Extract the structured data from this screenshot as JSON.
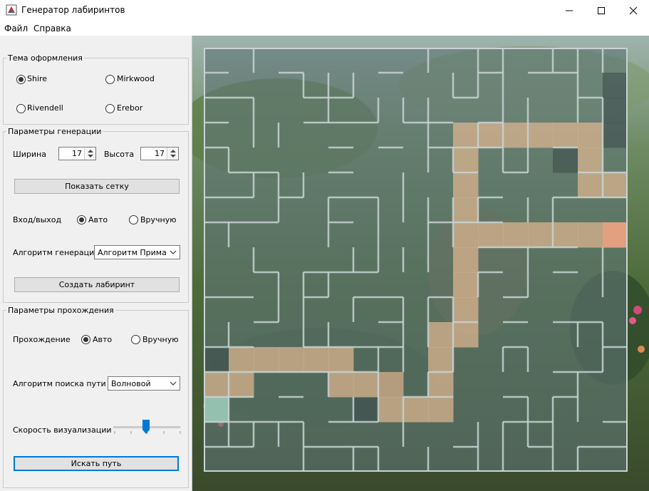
{
  "window": {
    "title": "Генератор лабиринтов"
  },
  "menu": {
    "file": "Файл",
    "help": "Справка"
  },
  "theme": {
    "legend": "Тема оформления",
    "options": [
      "Shire",
      "Mirkwood",
      "Rivendell",
      "Erebor"
    ],
    "selected": "Shire"
  },
  "gen": {
    "legend": "Параметры генерации",
    "width_label": "Ширина",
    "width_value": "17",
    "height_label": "Высота",
    "height_value": "17",
    "show_grid": "Показать сетку",
    "entry_label": "Вход/выход",
    "auto": "Авто",
    "manual": "Вручную",
    "algo_label": "Алгоритм генерации",
    "algo_value": "Алгоритм Прима",
    "create": "Создать лабиринт"
  },
  "solve": {
    "legend": "Параметры прохождения",
    "mode_label": "Прохождение",
    "auto": "Авто",
    "manual": "Вручную",
    "algo_label": "Алгоритм поиска пути",
    "algo_value": "Волновой",
    "speed_label": "Скорость визуализации",
    "speed_value": 0.5,
    "find": "Искать путь"
  },
  "maze": {
    "cols": 17,
    "rows": 17,
    "path": [
      [
        16,
        7
      ],
      [
        15,
        7
      ],
      [
        14,
        7
      ],
      [
        13,
        7
      ],
      [
        12,
        7
      ],
      [
        11,
        7
      ],
      [
        10,
        7
      ],
      [
        10,
        6
      ],
      [
        10,
        5
      ],
      [
        10,
        4
      ],
      [
        10,
        3
      ],
      [
        11,
        3
      ],
      [
        12,
        3
      ],
      [
        13,
        3
      ],
      [
        14,
        3
      ],
      [
        15,
        3
      ],
      [
        15,
        4
      ],
      [
        15,
        5
      ],
      [
        16,
        5
      ],
      [
        10,
        8
      ],
      [
        10,
        9
      ],
      [
        10,
        10
      ],
      [
        10,
        11
      ],
      [
        9,
        11
      ],
      [
        9,
        12
      ],
      [
        9,
        13
      ],
      [
        9,
        14
      ],
      [
        8,
        14
      ],
      [
        7,
        14
      ],
      [
        7,
        13
      ],
      [
        6,
        13
      ],
      [
        5,
        13
      ],
      [
        5,
        12
      ],
      [
        4,
        12
      ],
      [
        3,
        12
      ],
      [
        2,
        12
      ],
      [
        1,
        12
      ],
      [
        1,
        13
      ],
      [
        0,
        13
      ],
      [
        0,
        14
      ]
    ],
    "entry": [
      0,
      14
    ],
    "exit": [
      16,
      7
    ],
    "dark_cells": [
      [
        16,
        1
      ],
      [
        16,
        2
      ],
      [
        16,
        3
      ],
      [
        0,
        12
      ],
      [
        6,
        14
      ],
      [
        7,
        13
      ],
      [
        14,
        4
      ]
    ]
  },
  "colors": {
    "path": "#d9b48f",
    "entry": "#8fc3b4",
    "exit": "#e8a080",
    "dark": "#3d4d4d",
    "wall": "#c8d4d4"
  }
}
